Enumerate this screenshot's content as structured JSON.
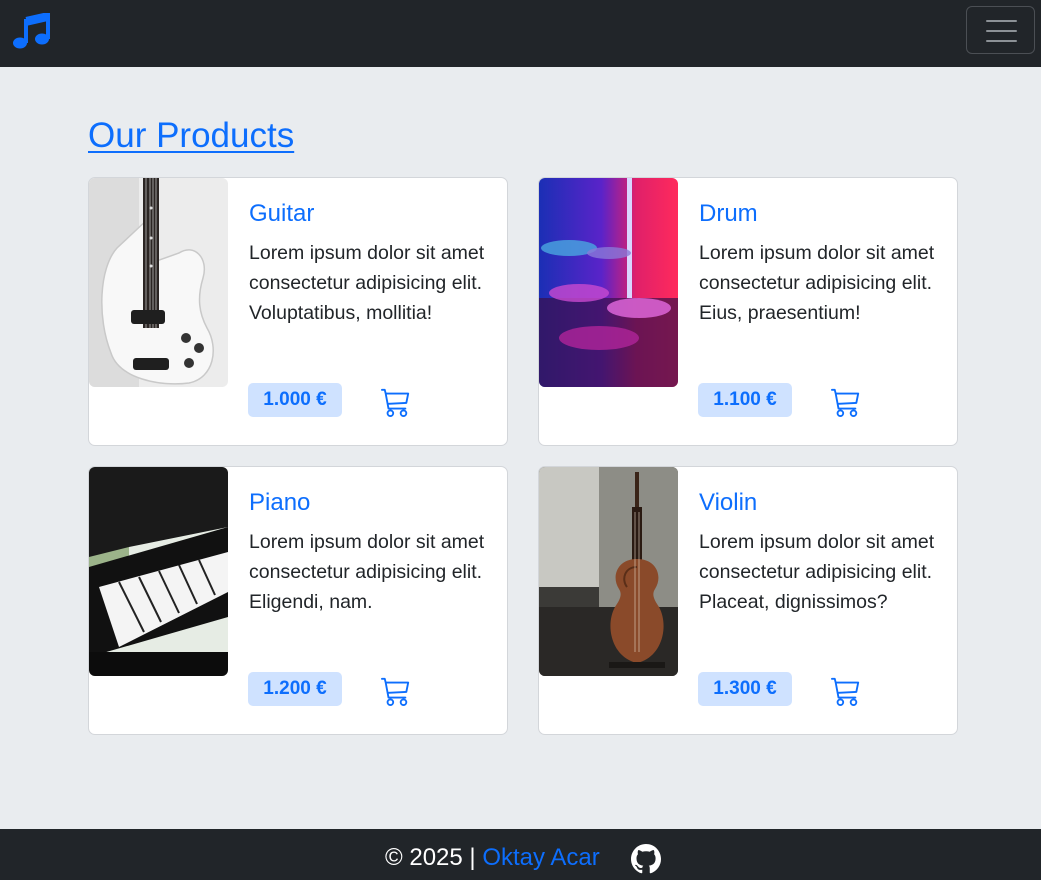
{
  "navbar": {
    "brand_icon": "music-note-icon",
    "menu_icon": "hamburger-icon",
    "accent": "#0d6efd"
  },
  "heading": "Our Products",
  "products": [
    {
      "name": "Guitar",
      "description": "Lorem ipsum dolor sit amet consectetur adipisicing elit. Voluptatibus, mollitia!",
      "price": "1.000 €"
    },
    {
      "name": "Drum",
      "description": "Lorem ipsum dolor sit amet consectetur adipisicing elit. Eius, praesentium!",
      "price": "1.100 €"
    },
    {
      "name": "Piano",
      "description": "Lorem ipsum dolor sit amet consectetur adipisicing elit. Eligendi, nam.",
      "price": "1.200 €"
    },
    {
      "name": "Violin",
      "description": "Lorem ipsum dolor sit amet consectetur adipisicing elit. Placeat, dignissimos?",
      "price": "1.300 €"
    }
  ],
  "footer": {
    "copyright": "© 2025 |",
    "author": "Oktay Acar",
    "icon": "github-icon"
  }
}
